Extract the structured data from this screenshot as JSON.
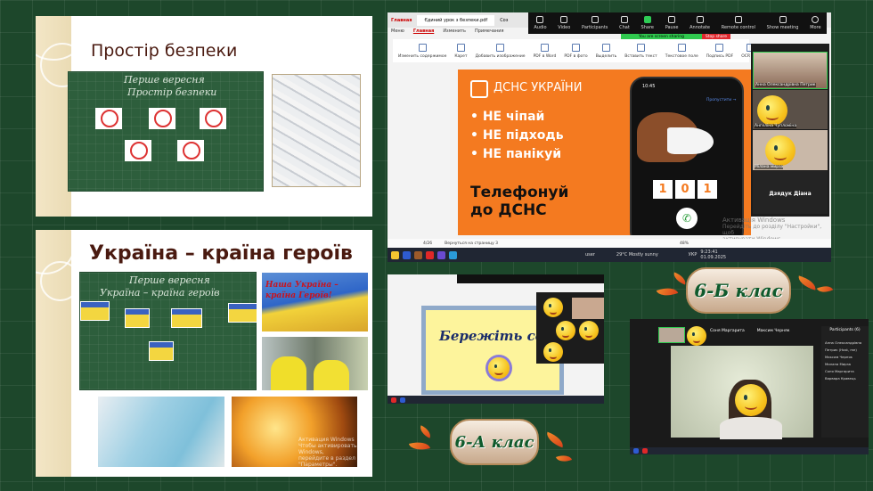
{
  "slide1": {
    "title": "Простір безпеки",
    "board_lines": [
      "Перше вересня",
      "Простір безпеки"
    ]
  },
  "slide2": {
    "title": "Україна – країна героїв",
    "board_lines": [
      "Перше вересня",
      "Україна – країна героїв"
    ],
    "flag_caption": "Наша Україна – країна Героїв!",
    "watermark": [
      "Активация Windows",
      "Чтобы активировать Windows,",
      "перейдите в раздел \"Параметры\"."
    ]
  },
  "main_screen": {
    "tabs": [
      "Главная",
      "Єдиний урок з безпеки.pdf",
      "Соз"
    ],
    "menu": [
      "Меню",
      "Главная",
      "Изменить",
      "Примечания"
    ],
    "zoom_toolbar": [
      {
        "label": "Audio"
      },
      {
        "label": "Video"
      },
      {
        "label": "Participants",
        "count": "19"
      },
      {
        "label": "Chat"
      },
      {
        "label": "Share"
      },
      {
        "label": "Pause"
      },
      {
        "label": "Annotate"
      },
      {
        "label": "Remote control"
      },
      {
        "label": "Show meeting"
      },
      {
        "label": "More"
      }
    ],
    "sharing_banner": "You are screen sharing",
    "stop_share": "Stop share",
    "ribbon": [
      "Изменить содержимое",
      "Карет",
      "Добавить изображение",
      "PDF в Word",
      "PDF в фото",
      "Выделить",
      "Вставить текст",
      "Текстовое поле",
      "Подпись PDF",
      "OCR PDF",
      "Извлечь текст"
    ],
    "pdf_slide": {
      "brand": "ДСНС УКРАЇНИ",
      "bullets": [
        "НЕ чіпай",
        "НЕ підходь",
        "НЕ панікуй"
      ],
      "call": [
        "Телефонуй",
        "до ДСНС"
      ],
      "phone_time": "10:45",
      "skip": "Пропустити →",
      "digits": [
        "1",
        "0",
        "1"
      ]
    },
    "participants": [
      "Анна Олександрівна Петрик",
      "Ангеліна Чупломіна",
      "Мілана мирза",
      "Дзядук Діана"
    ],
    "status": {
      "page": "4/26",
      "back": "Вернуться на страницу 3",
      "zoom": "48%"
    },
    "watermark": [
      "Активація Windows",
      "Перейдіть до розділу \"Настройки\", щоб",
      "активувати Windows."
    ],
    "taskbar": {
      "user": "user",
      "weather": "29°C  Mostly sunny",
      "lang": "УКР",
      "time": "9:23:41",
      "date": "01.09.2025"
    }
  },
  "class_a": {
    "label": "6-А клас",
    "slide_text": "Бережіть се"
  },
  "class_b": {
    "label": "6-Б клас",
    "panel_title": "Participants (6)",
    "participants": [
      "Анна Олександрівна Петрик (Host, me)",
      "Максим Черняк",
      "Милана Мирза",
      "Соня Маргарита",
      "Варвара Кравець"
    ],
    "top_tiles": [
      "Соня Маргарита",
      "Максим Черняк"
    ]
  },
  "colors": {
    "background": "#1d472b",
    "dsns_orange": "#f47a20",
    "title_brown": "#4a1a10",
    "badge_green": "#0f5a2c"
  }
}
